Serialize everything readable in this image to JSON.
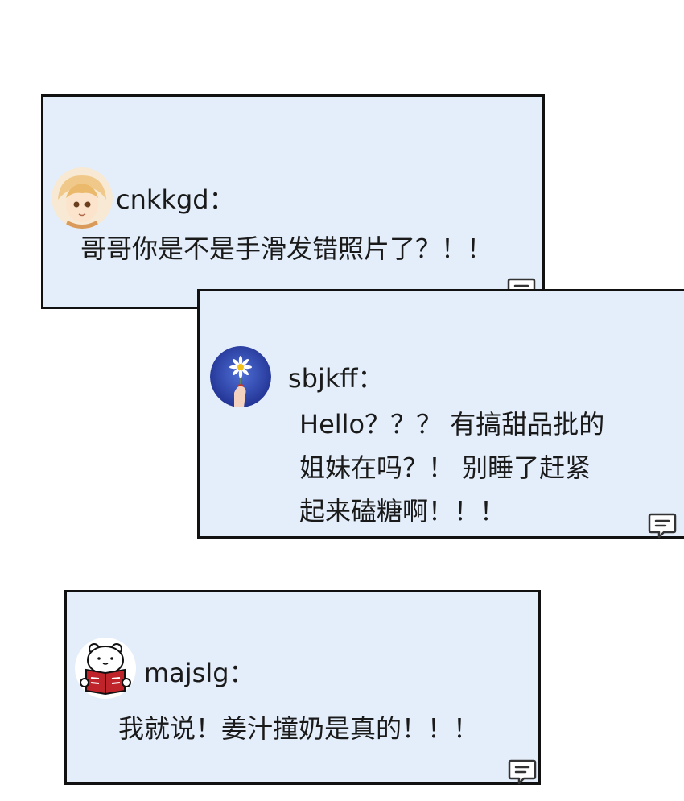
{
  "comments": [
    {
      "username": "cnkkgd",
      "separator": "：",
      "lines": [
        "哥哥你是不是手滑发错照片了？！！"
      ]
    },
    {
      "username": "sbjkff",
      "separator": "：",
      "lines": [
        "Hello？？？ 有搞甜品批的",
        "姐妹在吗？！ 别睡了赶紧",
        "起来磕糖啊！！！"
      ]
    },
    {
      "username": "majslg",
      "separator": "：",
      "lines": [
        "我就说！姜汁撞奶是真的！！！"
      ]
    }
  ],
  "icons": {
    "comment": "comment-bubble-icon"
  },
  "colors": {
    "panel_bg": "#e4eefa",
    "panel_border": "#111111",
    "text": "#1a1a1a"
  }
}
